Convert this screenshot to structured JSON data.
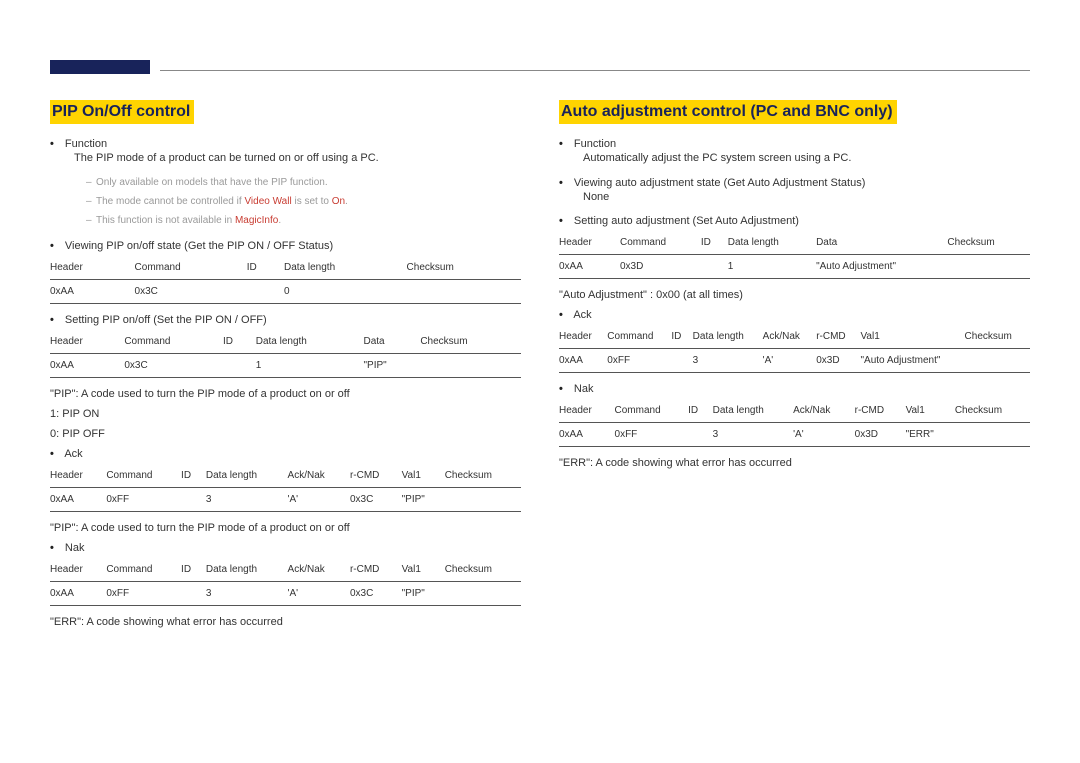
{
  "left": {
    "title": "PIP On/Off control",
    "func_label": "•",
    "func_hdr": "Function",
    "func_text": "The PIP mode of a product can be turned on or off using a PC.",
    "notes": [
      {
        "pre": "Only available on models that have the PIP function.",
        "red": "",
        "post": ""
      },
      {
        "pre": "The mode cannot be controlled if ",
        "red": "Video Wall",
        "post": " is set to ",
        "red2": "On",
        "post2": "."
      },
      {
        "pre": "This function is not available in ",
        "red": "MagicInfo",
        "post": "."
      }
    ],
    "view_label": "•",
    "view_text": "Viewing PIP on/off state (Get the PIP ON / OFF Status)",
    "view_table": {
      "head": [
        "Header",
        "Command",
        "ID",
        "Data length",
        "Checksum"
      ],
      "rows": [
        [
          "0xAA",
          "0x3C",
          "",
          "0",
          ""
        ]
      ]
    },
    "set_label": "•",
    "set_text": "Setting PIP on/off (Set the PIP ON / OFF)",
    "set_table": {
      "head": [
        "Header",
        "Command",
        "ID",
        "Data length",
        "Data",
        "Checksum"
      ],
      "rows": [
        [
          "0xAA",
          "0x3C",
          "",
          "1",
          "\"PIP\"",
          ""
        ]
      ]
    },
    "pip_desc": "\"PIP\": A code used to turn the PIP mode of a product on or off",
    "pip_on": "1: PIP ON",
    "pip_off": "0: PIP OFF",
    "ack_label": "•",
    "ack_text": "Ack",
    "ack_table": {
      "head": [
        "Header",
        "Command",
        "ID",
        "Data length",
        "Ack/Nak",
        "r-CMD",
        "Val1",
        "Checksum"
      ],
      "rows": [
        [
          "0xAA",
          "0xFF",
          "",
          "3",
          "'A'",
          "0x3C",
          "\"PIP\"",
          ""
        ]
      ]
    },
    "pip_desc2": "\"PIP\": A code used to turn the PIP mode of a product on or off",
    "nak_label": "•",
    "nak_text": "Nak",
    "nak_table": {
      "head": [
        "Header",
        "Command",
        "ID",
        "Data length",
        "Ack/Nak",
        "r-CMD",
        "Val1",
        "Checksum"
      ],
      "rows": [
        [
          "0xAA",
          "0xFF",
          "",
          "3",
          "'A'",
          "0x3C",
          "\"PIP\"",
          ""
        ]
      ]
    },
    "err_text": "\"ERR\": A code showing what error has occurred"
  },
  "right": {
    "title": "Auto adjustment control (PC and BNC only)",
    "func_label": "•",
    "func_hdr": "Function",
    "func_text": "Automatically adjust the PC system screen using a PC.",
    "view_label": "•",
    "view_text": "Viewing auto adjustment state (Get Auto Adjustment Status)",
    "view_none": "None",
    "set_label": "•",
    "set_text": "Setting auto adjustment (Set Auto Adjustment)",
    "set_table": {
      "head": [
        "Header",
        "Command",
        "ID",
        "Data length",
        "Data",
        "Checksum"
      ],
      "rows": [
        [
          "0xAA",
          "0x3D",
          "",
          "1",
          "\"Auto Adjustment\"",
          ""
        ]
      ]
    },
    "auto_desc": "\"Auto Adjustment\" : 0x00 (at all times)",
    "ack_label": "•",
    "ack_text": "Ack",
    "ack_table": {
      "head": [
        "Header",
        "Command",
        "ID",
        "Data length",
        "Ack/Nak",
        "r-CMD",
        "Val1",
        "Checksum"
      ],
      "rows": [
        [
          "0xAA",
          "0xFF",
          "",
          "3",
          "'A'",
          "0x3D",
          "\"Auto Adjustment\"",
          ""
        ]
      ]
    },
    "nak_label": "•",
    "nak_text": "Nak",
    "nak_table": {
      "head": [
        "Header",
        "Command",
        "ID",
        "Data length",
        "Ack/Nak",
        "r-CMD",
        "Val1",
        "Checksum"
      ],
      "rows": [
        [
          "0xAA",
          "0xFF",
          "",
          "3",
          "'A'",
          "0x3D",
          "\"ERR\"",
          ""
        ]
      ]
    },
    "err_text": "\"ERR\": A code showing what error has occurred"
  }
}
